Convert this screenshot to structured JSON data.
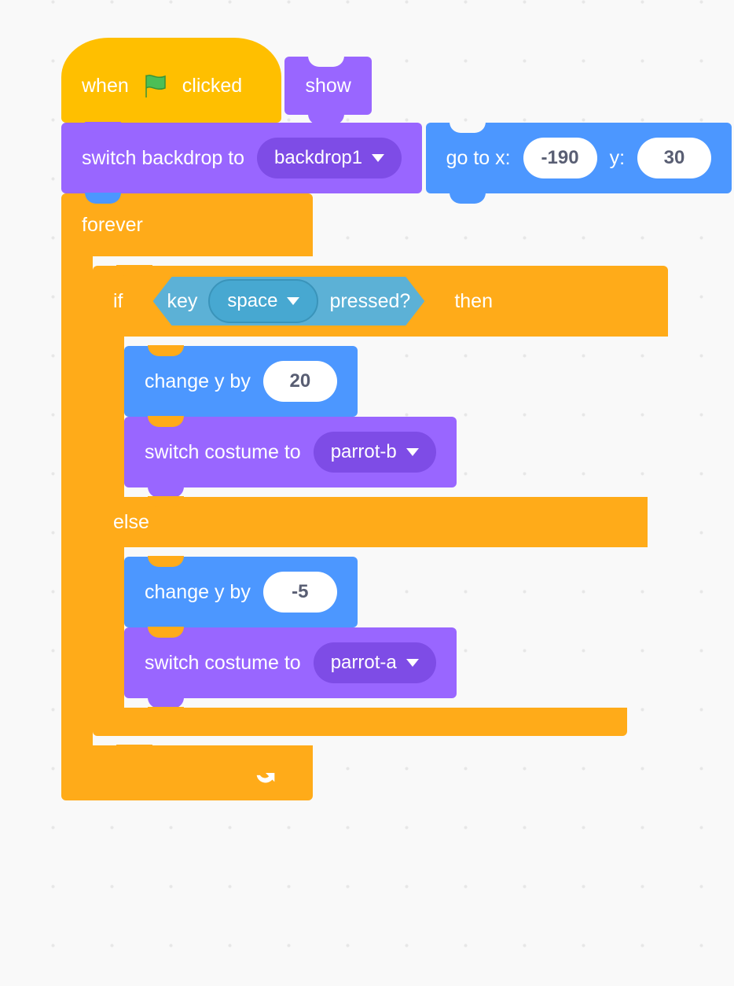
{
  "hat": {
    "pre": "when",
    "post": "clicked",
    "icon": "green-flag"
  },
  "show": {
    "label": "show"
  },
  "switch_backdrop": {
    "label_pre": "switch backdrop to",
    "option": "backdrop1"
  },
  "goto": {
    "label_x": "go to x:",
    "x": "-190",
    "label_y": "y:",
    "y": "30"
  },
  "forever": {
    "label": "forever"
  },
  "if": {
    "label_if": "if",
    "label_then": "then",
    "label_else": "else"
  },
  "key_pressed": {
    "label_pre": "key",
    "option": "space",
    "label_post": "pressed?"
  },
  "change_y_up": {
    "label": "change y by",
    "value": "20"
  },
  "switch_cost_b": {
    "label": "switch costume to",
    "option": "parrot-b"
  },
  "change_y_dn": {
    "label": "change y by",
    "value": "-5"
  },
  "switch_cost_a": {
    "label": "switch costume to",
    "option": "parrot-a"
  }
}
